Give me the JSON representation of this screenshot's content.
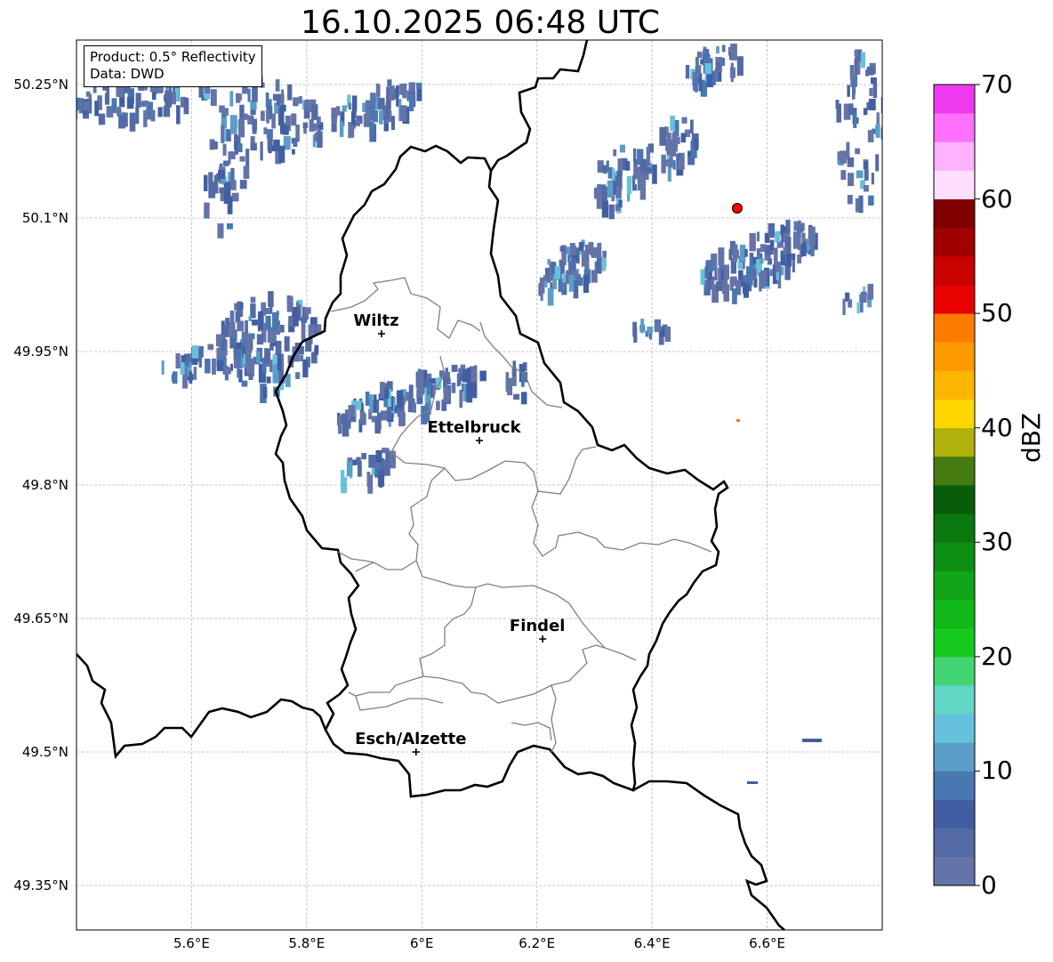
{
  "title": "16.10.2025 06:48 UTC",
  "info_box": {
    "product": "Product: 0.5° Reflectivity",
    "data": "Data: DWD"
  },
  "axes": {
    "lon_ticks": [
      {
        "value": 5.6,
        "label": "5.6°E"
      },
      {
        "value": 5.8,
        "label": "5.8°E"
      },
      {
        "value": 6.0,
        "label": "6°E"
      },
      {
        "value": 6.2,
        "label": "6.2°E"
      },
      {
        "value": 6.4,
        "label": "6.4°E"
      },
      {
        "value": 6.6,
        "label": "6.6°E"
      }
    ],
    "lat_ticks": [
      {
        "value": 50.25,
        "label": "50.25°N"
      },
      {
        "value": 50.1,
        "label": "50.1°N"
      },
      {
        "value": 49.95,
        "label": "49.95°N"
      },
      {
        "value": 49.8,
        "label": "49.8°N"
      },
      {
        "value": 49.65,
        "label": "49.65°N"
      },
      {
        "value": 49.5,
        "label": "49.5°N"
      },
      {
        "value": 49.35,
        "label": "49.35°N"
      }
    ],
    "lon_range": [
      5.4,
      6.8
    ],
    "lat_range": [
      49.3,
      50.3
    ],
    "grid": true
  },
  "cities": [
    {
      "name": "Wiltz",
      "lon": 5.93,
      "lat": 49.97
    },
    {
      "name": "Ettelbruck",
      "lon": 6.1,
      "lat": 49.85
    },
    {
      "name": "Findel",
      "lon": 6.21,
      "lat": 49.627
    },
    {
      "name": "Esch/Alzette",
      "lon": 5.99,
      "lat": 49.5
    }
  ],
  "radar_site": {
    "lon": 6.548,
    "lat": 50.111,
    "color": "#ff0000"
  },
  "colorbar": {
    "label": "dBZ",
    "min": 0,
    "max": 70,
    "ticks": [
      0,
      10,
      20,
      30,
      40,
      50,
      60,
      70
    ],
    "colors": [
      "#6474a8",
      "#536aa4",
      "#425ea2",
      "#4877b1",
      "#5a9ec8",
      "#66c2dc",
      "#62d6c4",
      "#42d472",
      "#14c81e",
      "#10b81a",
      "#10a416",
      "#0e8e12",
      "#0a780e",
      "#085c0a",
      "#447a10",
      "#aeb20a",
      "#ffd600",
      "#ffb600",
      "#ff9a00",
      "#ff7c00",
      "#e80000",
      "#c80000",
      "#a00000",
      "#800000",
      "#ffddff",
      "#ffb2ff",
      "#ff70ff",
      "#ee3aee"
    ]
  },
  "colors": {
    "border": "#000000",
    "canton": "#808080",
    "grid": "#b8b8b8"
  }
}
